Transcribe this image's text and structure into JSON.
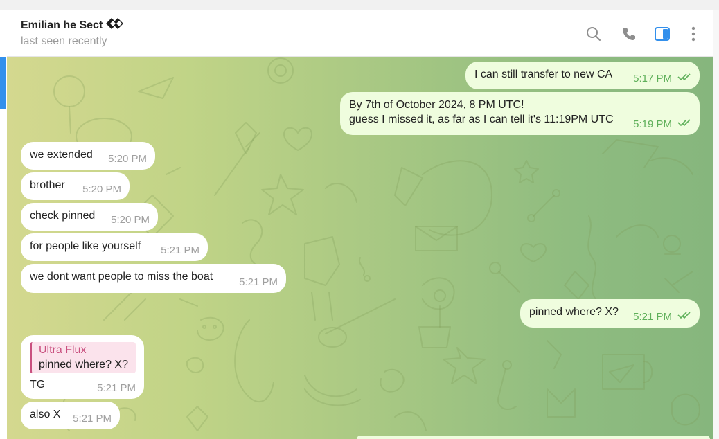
{
  "header": {
    "contact_name": "Emilian he Sect",
    "status": "last seen recently"
  },
  "messages": [
    {
      "direction": "out",
      "text": "I can still transfer to new CA",
      "time": "5:17 PM",
      "read": true
    },
    {
      "direction": "out",
      "lines": [
        "By 7th of October 2024, 8 PM UTC!",
        "guess I missed it, as far as I can tell it's 11:19PM UTC"
      ],
      "time": "5:19 PM",
      "read": true
    },
    {
      "direction": "in",
      "text": "we extended",
      "time": "5:20 PM"
    },
    {
      "direction": "in",
      "text": "brother",
      "time": "5:20 PM"
    },
    {
      "direction": "in",
      "text": "check pinned",
      "time": "5:20 PM"
    },
    {
      "direction": "in",
      "text": "for people like yourself",
      "time": "5:21 PM"
    },
    {
      "direction": "in",
      "text": "we dont want people to miss the boat",
      "time": "5:21 PM"
    },
    {
      "direction": "out",
      "text": "pinned where? X?",
      "time": "5:21 PM",
      "read": true
    },
    {
      "direction": "in",
      "reply_to": {
        "author": "Ultra Flux",
        "text": "pinned where? X?"
      },
      "text": "TG",
      "time": "5:21 PM"
    },
    {
      "direction": "in",
      "text": "also X",
      "time": "5:21 PM"
    }
  ],
  "icons": {
    "search": "search-icon",
    "call": "phone-icon",
    "sidebar": "sidebar-toggle-icon",
    "more": "more-vertical-icon",
    "emoji": "diamond-emoji-icon",
    "read": "double-check-icon"
  },
  "colors": {
    "accent": "#3390ec",
    "outgoing_bubble": "#effdde",
    "incoming_bubble": "#ffffff",
    "reply_accent": "#c9507f",
    "read_check": "#5fb05a"
  }
}
